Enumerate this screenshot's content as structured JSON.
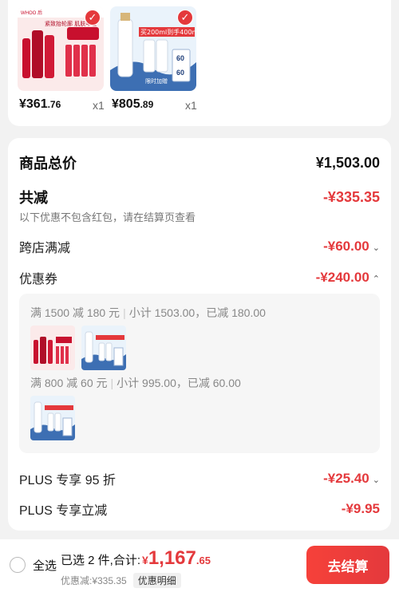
{
  "products": [
    {
      "price_int": "¥361",
      "price_dec": ".76",
      "qty": "x1",
      "brand_text": "WHOO 后",
      "promo_text": "紧致抬轮廓 肌肤年轻"
    },
    {
      "price_int": "¥805",
      "price_dec": ".89",
      "qty": "x1",
      "promo_text": "买200ml到手400ml",
      "tag": "限时加赠"
    }
  ],
  "summary": {
    "goods_total_label": "商品总价",
    "goods_total_value": "¥1,503.00",
    "total_discount_label": "共减",
    "total_discount_value": "-¥335.35",
    "note": "以下优惠不包含红包，请在结算页查看",
    "cross_store_label": "跨店满减",
    "cross_store_value": "-¥60.00",
    "coupon_label": "优惠券",
    "coupon_value": "-¥240.00",
    "coupons": [
      {
        "rule": "满 1500 减 180 元",
        "detail": "小计 1503.00，已减 180.00"
      },
      {
        "rule": "满 800 减 60 元",
        "detail": "小计 995.00，已减 60.00"
      }
    ],
    "plus95_label": "PLUS 专享 95 折",
    "plus95_value": "-¥25.40",
    "plus_direct_label": "PLUS 专享立减",
    "plus_direct_value": "-¥9.95"
  },
  "footer": {
    "select_all": "全选",
    "selected_text": "已选 2 件,合计:",
    "currency": "¥",
    "total_int": "1,167",
    "total_dec": ".65",
    "discount_text": "优惠减:¥335.35",
    "discount_detail": "优惠明细",
    "checkout_label": "去结算"
  },
  "colors": {
    "accent": "#e4393c",
    "background": "#f2f2f2"
  },
  "icons": {
    "check": "check-icon",
    "chevron_down": "chevron-down-icon",
    "chevron_up": "chevron-up-icon",
    "radio": "radio-icon"
  }
}
